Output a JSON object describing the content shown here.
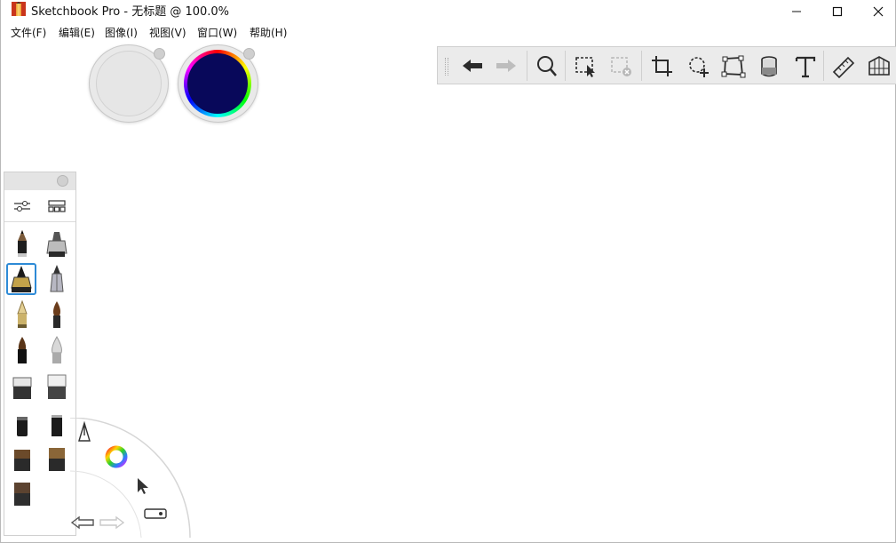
{
  "window": {
    "title": "Sketchbook Pro - 无标题 @ 100.0%",
    "controls": {
      "minimize_icon": "minimize-icon",
      "maximize_icon": "maximize-icon",
      "close_icon": "close-icon"
    }
  },
  "menu": {
    "items": [
      "文件(F)",
      "编辑(E)",
      "图像(I)",
      "视图(V)",
      "窗口(W)",
      "帮助(H)"
    ]
  },
  "colors": {
    "puck_left": "#e6e6e6",
    "puck_right": "#08085a",
    "selection_blue": "#2d8ad6"
  },
  "toolbar": {
    "tools": [
      "undo",
      "redo",
      "zoom",
      "select",
      "clear-selection",
      "crop",
      "add-layer",
      "transform",
      "bucket-fill",
      "text",
      "ruler",
      "perspective"
    ]
  },
  "palette": {
    "tool_icons": [
      "brush-properties-icon",
      "brush-library-icon"
    ],
    "brushes": [
      "pencil",
      "marker-flat",
      "inking-pen",
      "technical-pen",
      "fountain-pen",
      "paint-brush-round",
      "calligraphy-brush",
      "airbrush",
      "eraser-hard",
      "eraser-soft",
      "felt-pen",
      "chisel-marker",
      "paint-brush-flat",
      "paint-brush-wide",
      "paint-brush-broad"
    ],
    "selected_index": 2
  },
  "lagoon": {
    "items": [
      "brush-icon",
      "color-wheel-icon",
      "pointer-icon",
      "toggle-ui-icon",
      "undo-icon",
      "redo-icon"
    ]
  }
}
